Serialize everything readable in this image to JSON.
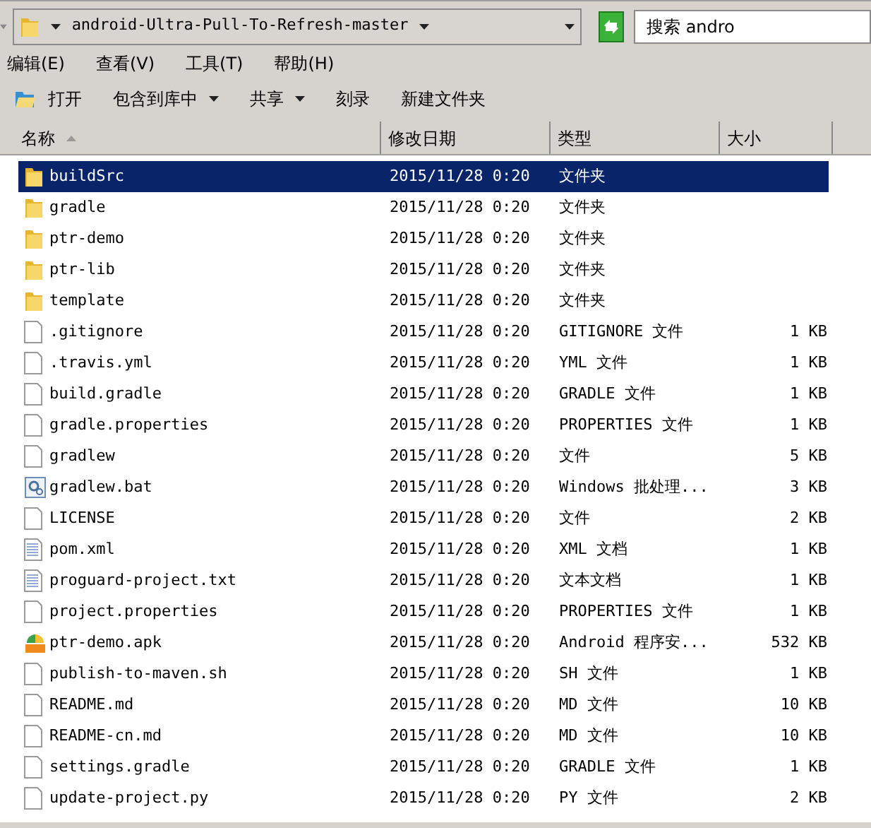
{
  "address_bar": {
    "path": "android-Ultra-Pull-To-Refresh-master"
  },
  "search": {
    "placeholder": "搜索 andro"
  },
  "menu": [
    "编辑(E)",
    "查看(V)",
    "工具(T)",
    "帮助(H)"
  ],
  "toolbar": [
    {
      "label": "打开",
      "kind": "open"
    },
    {
      "label": "包含到库中",
      "kind": "dropdown"
    },
    {
      "label": "共享",
      "kind": "dropdown"
    },
    {
      "label": "刻录",
      "kind": "plain"
    },
    {
      "label": "新建文件夹",
      "kind": "plain"
    }
  ],
  "columns": [
    {
      "label": "名称",
      "sorted": true
    },
    {
      "label": "修改日期",
      "sorted": false
    },
    {
      "label": "类型",
      "sorted": false
    },
    {
      "label": "大小",
      "sorted": false
    }
  ],
  "rows": [
    {
      "name": "buildSrc",
      "date": "2015/11/28 0:20",
      "type": "文件夹",
      "kind": "folder",
      "selected": true
    },
    {
      "name": "gradle",
      "date": "2015/11/28 0:20",
      "type": "文件夹",
      "kind": "folder",
      "selected": false
    },
    {
      "name": "ptr-demo",
      "date": "2015/11/28 0:20",
      "type": "文件夹",
      "kind": "folder",
      "selected": false
    },
    {
      "name": "ptr-lib",
      "date": "2015/11/28 0:20",
      "type": "文件夹",
      "kind": "folder",
      "selected": false
    },
    {
      "name": "template",
      "date": "2015/11/28 0:20",
      "type": "文件夹",
      "kind": "folder",
      "selected": false
    },
    {
      "name": ".gitignore",
      "date": "2015/11/28 0:20",
      "type": "GITIGNORE 文件",
      "size": "1 KB",
      "kind": "file",
      "selected": false
    },
    {
      "name": ".travis.yml",
      "date": "2015/11/28 0:20",
      "type": "YML 文件",
      "size": "1 KB",
      "kind": "file",
      "selected": false
    },
    {
      "name": "build.gradle",
      "date": "2015/11/28 0:20",
      "type": "GRADLE 文件",
      "size": "1 KB",
      "kind": "file",
      "selected": false
    },
    {
      "name": "gradle.properties",
      "date": "2015/11/28 0:20",
      "type": "PROPERTIES 文件",
      "size": "1 KB",
      "kind": "file",
      "selected": false
    },
    {
      "name": "gradlew",
      "date": "2015/11/28 0:20",
      "type": "文件",
      "size": "5 KB",
      "kind": "file",
      "selected": false
    },
    {
      "name": "gradlew.bat",
      "date": "2015/11/28 0:20",
      "type": "Windows 批处理...",
      "size": "3 KB",
      "kind": "batch",
      "selected": false
    },
    {
      "name": "LICENSE",
      "date": "2015/11/28 0:20",
      "type": "文件",
      "size": "2 KB",
      "kind": "file",
      "selected": false
    },
    {
      "name": "pom.xml",
      "date": "2015/11/28 0:20",
      "type": "XML 文档",
      "size": "1 KB",
      "kind": "text",
      "selected": false
    },
    {
      "name": "proguard-project.txt",
      "date": "2015/11/28 0:20",
      "type": "文本文档",
      "size": "1 KB",
      "kind": "text",
      "selected": false
    },
    {
      "name": "project.properties",
      "date": "2015/11/28 0:20",
      "type": "PROPERTIES 文件",
      "size": "1 KB",
      "kind": "file",
      "selected": false
    },
    {
      "name": "ptr-demo.apk",
      "date": "2015/11/28 0:20",
      "type": "Android 程序安...",
      "size": "532 KB",
      "kind": "apk",
      "selected": false
    },
    {
      "name": "publish-to-maven.sh",
      "date": "2015/11/28 0:20",
      "type": "SH 文件",
      "size": "1 KB",
      "kind": "file",
      "selected": false
    },
    {
      "name": "README.md",
      "date": "2015/11/28 0:20",
      "type": "MD 文件",
      "size": "10 KB",
      "kind": "file",
      "selected": false
    },
    {
      "name": "README-cn.md",
      "date": "2015/11/28 0:20",
      "type": "MD 文件",
      "size": "10 KB",
      "kind": "file",
      "selected": false
    },
    {
      "name": "settings.gradle",
      "date": "2015/11/28 0:20",
      "type": "GRADLE 文件",
      "size": "1 KB",
      "kind": "file",
      "selected": false
    },
    {
      "name": "update-project.py",
      "date": "2015/11/28 0:20",
      "type": "PY 文件",
      "size": "2 KB",
      "kind": "file",
      "selected": false
    }
  ]
}
